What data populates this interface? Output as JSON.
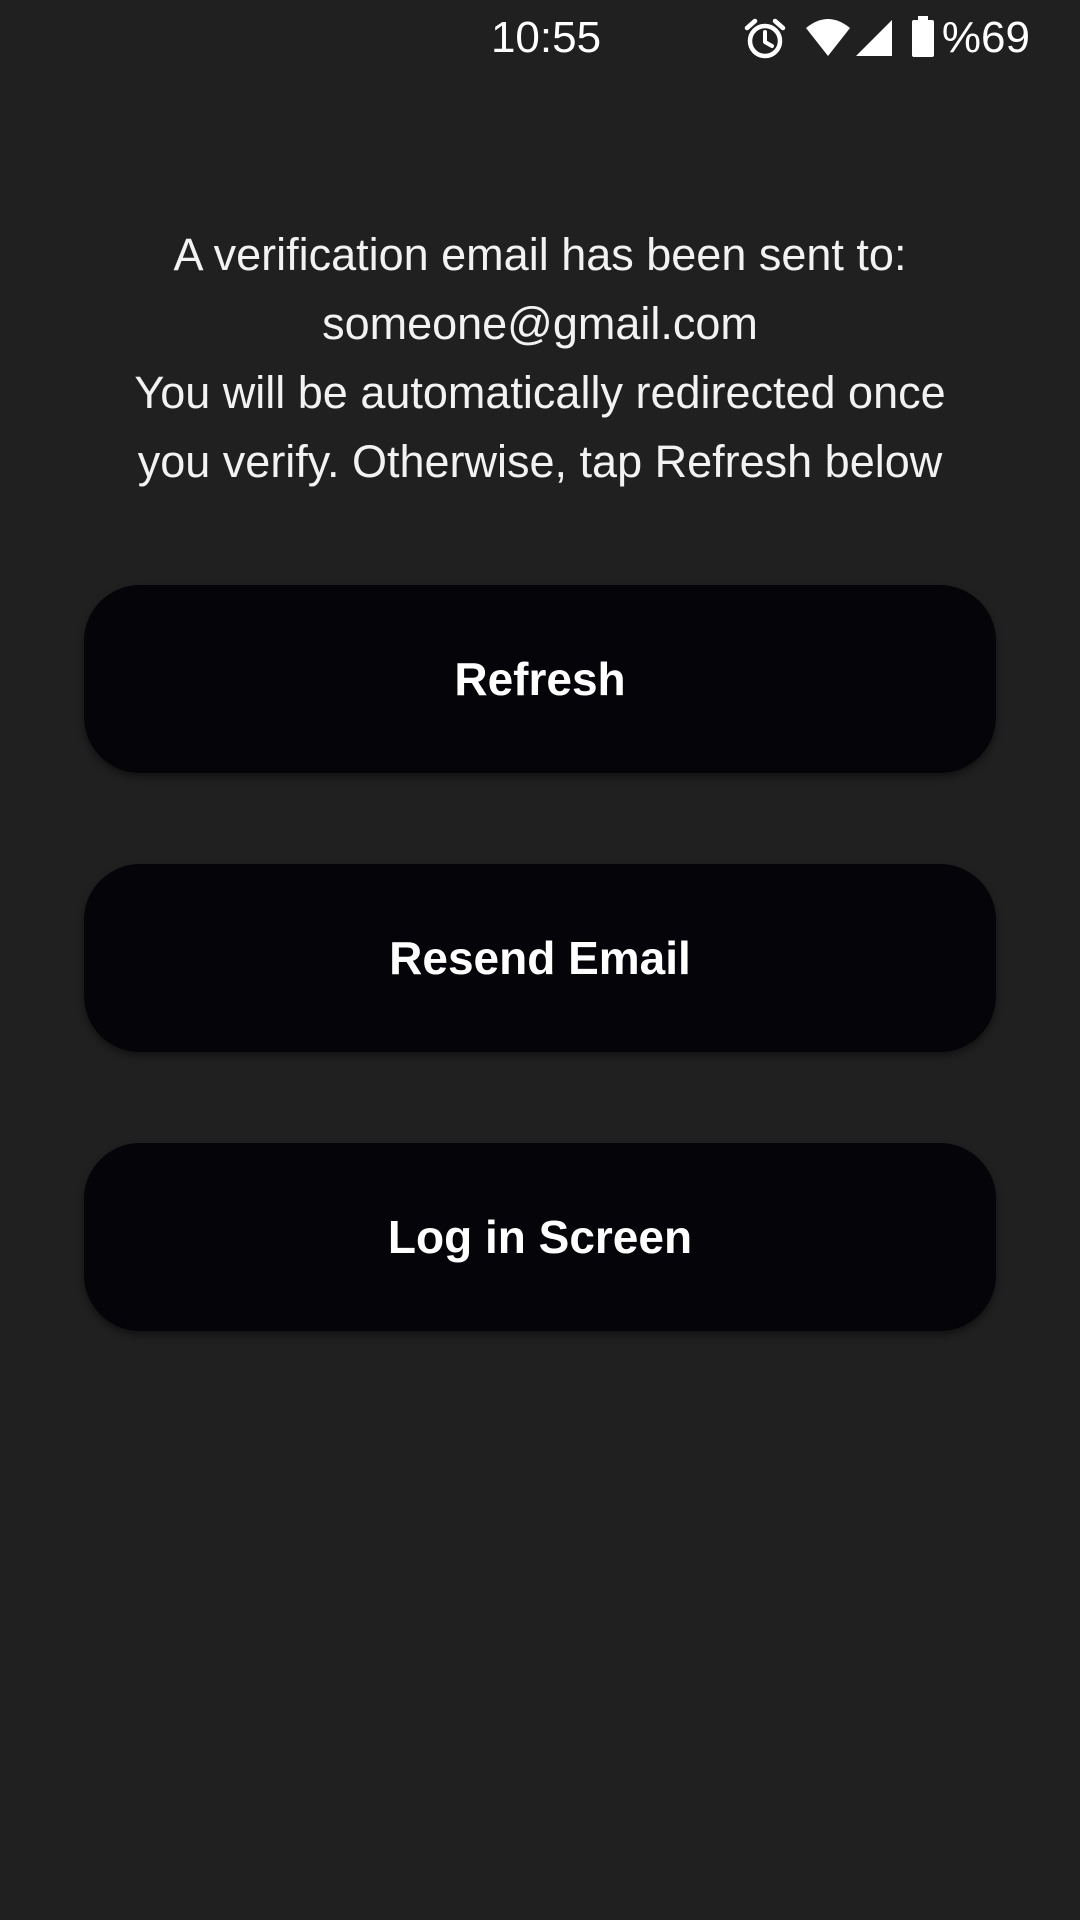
{
  "status_bar": {
    "time": "10:55",
    "battery_percent": "%69",
    "icons": [
      "alarm-icon",
      "wifi-icon",
      "signal-icon",
      "battery-icon"
    ]
  },
  "message": {
    "line1": "A verification email has been sent to:",
    "line2": "someone@gmail.com",
    "line3": "You will be automatically redirected once",
    "line4": "you verify. Otherwise, tap Refresh below"
  },
  "buttons": {
    "refresh": "Refresh",
    "resend": "Resend Email",
    "login": "Log in Screen"
  },
  "colors": {
    "background": "#202020",
    "button_background": "#050509",
    "text": "#ffffff"
  }
}
